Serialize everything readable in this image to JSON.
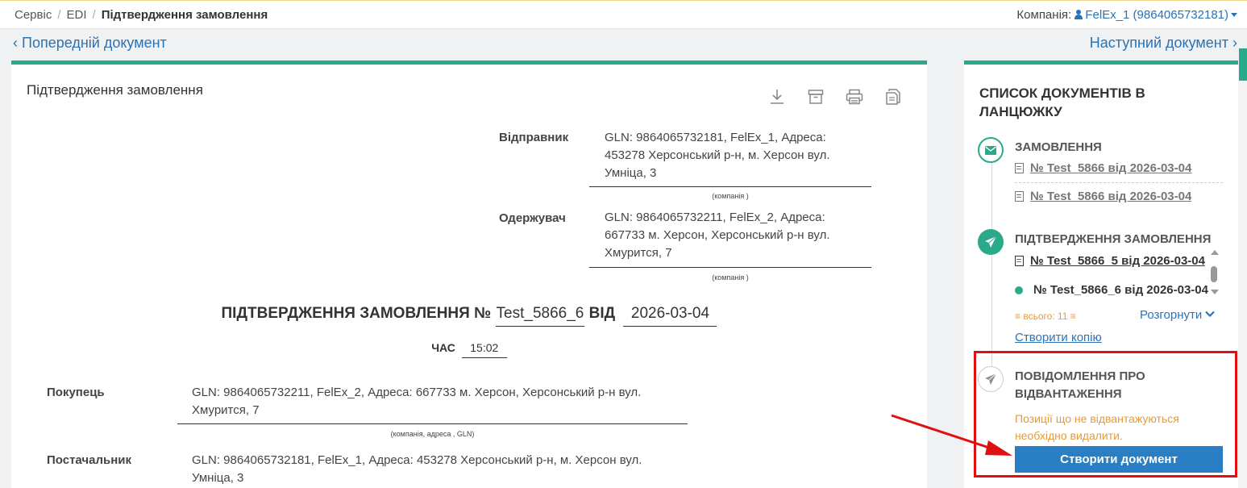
{
  "breadcrumb": {
    "items": [
      "Сервіс",
      "EDI"
    ],
    "current": "Підтвердження замовлення"
  },
  "company": {
    "label": "Компанія:",
    "value": "FelEx_1 (9864065732181)"
  },
  "nav": {
    "prev": "Попередній документ",
    "next": "Наступний документ"
  },
  "document": {
    "title": "Підтвердження замовлення",
    "sender": {
      "label": "Відправник",
      "lines": [
        "GLN: 9864065732181, FelEx_1, Адреса:",
        "453278 Херсонський р-н, м. Херсон вул.",
        "Умніца, 3"
      ],
      "caption": "(компанія )"
    },
    "receiver": {
      "label": "Одержувач",
      "lines": [
        "GLN: 9864065732211, FelEx_2, Адреса:",
        "667733 м. Херсон, Херсонський р-н вул.",
        "Хмурится, 7"
      ],
      "caption": "(компанія )"
    },
    "heading": {
      "prefix": "ПІДТВЕРДЖЕННЯ ЗАМОВЛЕННЯ №",
      "number": "Test_5866_6",
      "date_label": "ВІД",
      "date": "2026-03-04"
    },
    "time": {
      "label": "ЧАС",
      "value": "15:02"
    },
    "buyer": {
      "label": "Покупець",
      "lines": [
        "GLN: 9864065732211, FelEx_2, Адреса: 667733 м. Херсон, Херсонський р-н вул.",
        "Хмурится, 7"
      ],
      "caption": "(компанія, адреса , GLN)"
    },
    "supplier": {
      "label": "Постачальник",
      "lines": [
        "GLN: 9864065732181, FelEx_1, Адреса: 453278 Херсонський р-н, м. Херсон вул.",
        "Умніца, 3"
      ]
    }
  },
  "chain": {
    "title": "СПИСОК ДОКУМЕНТІВ В ЛАНЦЮЖКУ",
    "order": {
      "title": "ЗАМОВЛЕННЯ",
      "docs": [
        "№ Test_5866 від 2026-03-04",
        "№ Test_5866 від 2026-03-04"
      ]
    },
    "confirmation": {
      "title": "ПІДТВЕРДЖЕННЯ ЗАМОВЛЕННЯ",
      "docs": [
        "№ Test_5866_5 від 2026-03-04",
        "№ Test_5866_6 від 2026-03-04"
      ],
      "total": "всього: 11",
      "expand": "Розгорнути",
      "create_copy": "Створити копію"
    },
    "shipment": {
      "title": "ПОВІДОМЛЕННЯ ПРО ВІДВАНТАЖЕННЯ",
      "notice": "Позиції що не відвантажуються необхідно видалити.",
      "button": "Створити документ"
    }
  },
  "colors": {
    "accent_green": "#2aaa8a",
    "link_blue": "#2a73b5",
    "button_blue": "#2a7fc4",
    "warning_orange": "#e69a3a",
    "highlight_red": "#e01010"
  }
}
